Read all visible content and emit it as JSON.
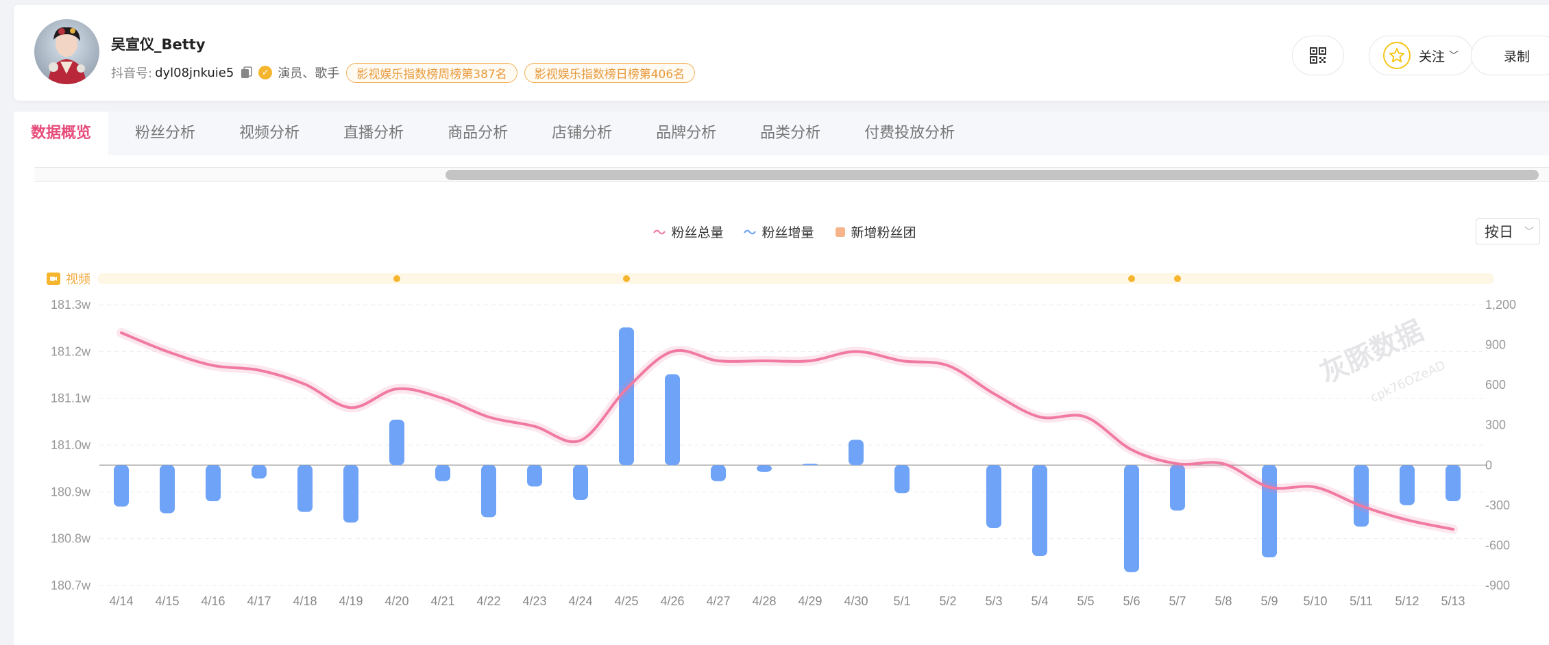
{
  "profile": {
    "name": "吴宣仪_Betty",
    "douyin_label": "抖音号:",
    "douyin_id": "dyl08jnkuie5",
    "occupation": "演员、歌手",
    "badges": [
      "影视娱乐指数榜周榜第387名",
      "影视娱乐指数榜日榜第406名"
    ]
  },
  "actions": {
    "follow_label": "关注",
    "record_label": "录制"
  },
  "tabs": [
    {
      "label": "数据概览",
      "active": true
    },
    {
      "label": "粉丝分析",
      "active": false
    },
    {
      "label": "视频分析",
      "active": false
    },
    {
      "label": "直播分析",
      "active": false
    },
    {
      "label": "商品分析",
      "active": false
    },
    {
      "label": "店铺分析",
      "active": false
    },
    {
      "label": "品牌分析",
      "active": false
    },
    {
      "label": "品类分析",
      "active": false
    },
    {
      "label": "付费投放分析",
      "active": false
    }
  ],
  "period_select": {
    "value": "按日"
  },
  "video_track_label": "视频",
  "watermark": {
    "main": "灰豚数据",
    "sub": "cpk76OZeAD"
  },
  "colors": {
    "accent": "#e74c7c",
    "line": "#f07aa0",
    "bar": "#6ea3f7",
    "badge": "#e89a3c",
    "video": "#f5b52e"
  },
  "chart_data": {
    "type": "bar",
    "categories": [
      "4/14",
      "4/15",
      "4/16",
      "4/17",
      "4/18",
      "4/19",
      "4/20",
      "4/21",
      "4/22",
      "4/23",
      "4/24",
      "4/25",
      "4/26",
      "4/27",
      "4/28",
      "4/29",
      "4/30",
      "5/1",
      "5/2",
      "5/3",
      "5/4",
      "5/5",
      "5/6",
      "5/7",
      "5/8",
      "5/9",
      "5/10",
      "5/11",
      "5/12",
      "5/13"
    ],
    "legend": [
      "粉丝总量",
      "粉丝增量",
      "新增粉丝团"
    ],
    "series": [
      {
        "name": "粉丝总量",
        "type": "line",
        "axis": "left",
        "values": [
          181.24,
          181.2,
          181.17,
          181.16,
          181.13,
          181.08,
          181.12,
          181.1,
          181.06,
          181.04,
          181.01,
          181.12,
          181.2,
          181.18,
          181.18,
          181.18,
          181.2,
          181.18,
          181.17,
          181.11,
          181.06,
          181.06,
          180.99,
          180.96,
          180.96,
          180.91,
          180.91,
          180.87,
          180.84,
          180.82
        ]
      },
      {
        "name": "粉丝增量",
        "type": "bar",
        "axis": "right",
        "values": [
          -310,
          -360,
          -270,
          -100,
          -350,
          -430,
          340,
          -120,
          -390,
          -160,
          -260,
          1030,
          680,
          -120,
          -50,
          10,
          190,
          -210,
          0,
          -470,
          -680,
          0,
          -800,
          -340,
          0,
          -690,
          0,
          -460,
          -300,
          -270
        ]
      }
    ],
    "y_left": {
      "ticks": [
        "181.3w",
        "181.2w",
        "181.1w",
        "181.0w",
        "180.9w",
        "180.8w",
        "180.7w"
      ],
      "range": [
        180.7,
        181.3
      ]
    },
    "y_right": {
      "ticks": [
        "1,200",
        "900",
        "600",
        "300",
        "0",
        "-300",
        "-600",
        "-900"
      ],
      "range": [
        -900,
        1200
      ]
    },
    "video_markers": [
      "4/20",
      "4/25",
      "5/6",
      "5/7"
    ],
    "grid": true,
    "legend_position": "top-center"
  }
}
